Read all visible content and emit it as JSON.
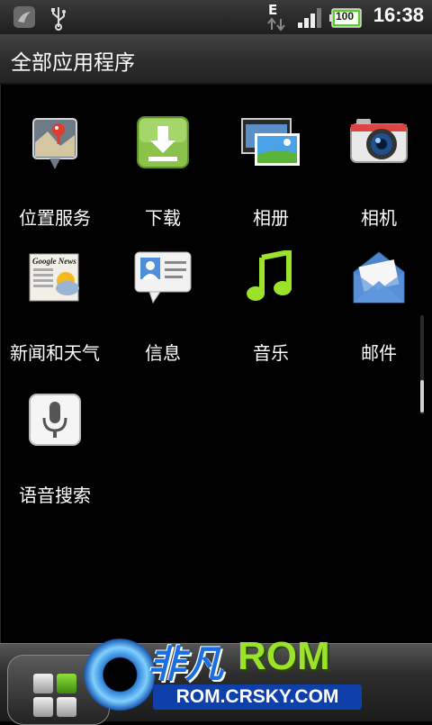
{
  "status_bar": {
    "time": "16:38",
    "network_type": "E",
    "battery_level": "100",
    "icons": [
      "notification-icon",
      "usb-icon",
      "data-arrows-icon",
      "signal-icon",
      "battery-icon"
    ]
  },
  "header": {
    "title": "全部应用程序"
  },
  "apps": [
    {
      "label": "位置服务",
      "icon": "location-icon"
    },
    {
      "label": "下载",
      "icon": "download-icon"
    },
    {
      "label": "相册",
      "icon": "gallery-icon"
    },
    {
      "label": "相机",
      "icon": "camera-icon"
    },
    {
      "label": "新闻和天气",
      "icon": "news-weather-icon"
    },
    {
      "label": "信息",
      "icon": "messages-icon"
    },
    {
      "label": "音乐",
      "icon": "music-icon"
    },
    {
      "label": "邮件",
      "icon": "mail-icon"
    },
    {
      "label": "语音搜索",
      "icon": "voice-search-icon"
    }
  ],
  "watermark": {
    "brand_cn": "非凡",
    "brand_rom": "ROM",
    "url": "ROM.CRSKY.COM"
  },
  "colors": {
    "background": "#000000",
    "download_green": "#8bc34a",
    "music_green": "#9be22a",
    "watermark_blue": "#1a6fe0"
  }
}
